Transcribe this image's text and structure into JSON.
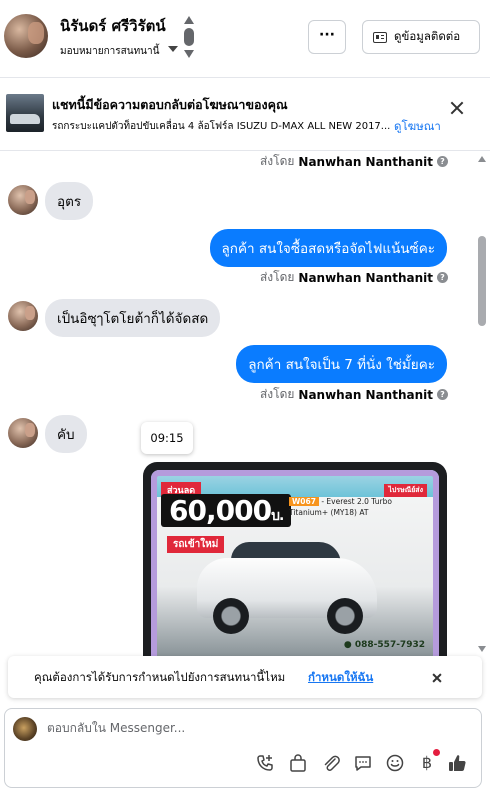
{
  "header": {
    "contact_name": "นิรันดร์ ศรีวิรัตน์",
    "assign_label": "มอบหมายการสนทนานี้",
    "more_label": "···",
    "view_contact_label": "ดูข้อมูลติดต่อ"
  },
  "ad_banner": {
    "title": "แชทนี้มีข้อความตอบกลับต่อโฆษณาของคุณ",
    "description": "รถกระบะแคปตัวท็อปขับเคลื่อน 4 ล้อโฟร์ล ISUZU D-MAX ALL NEW 2017...",
    "link": "ดูโฆษณา"
  },
  "thread": {
    "sent_by_prefix": "ส่งโดย",
    "agent_name": "Nanwhan Nanthanit",
    "info_glyph": "?",
    "messages": [
      {
        "text": "อุตร"
      },
      {
        "text": "ลูกค้า สนใจซื้อสดหรือจัดไฟแน้นซ์คะ"
      },
      {
        "text": "เป็นอิซุๅโตโยต้าก็ได้จัดสด"
      },
      {
        "text": "ลูกค้า สนใจเป็น 7 ที่นั่ง ใช่มั้ยคะ"
      },
      {
        "text": "คับ"
      }
    ],
    "tooltip_time": "09:15",
    "ad_image": {
      "tag": "ส่วนลด",
      "price": "60,000",
      "price_suffix": "บ.",
      "subtitle": "รถเข้าใหม่",
      "model_code": "W067",
      "model_line1": "- Everest 2.0 Turbo",
      "model_line2": "Titanium+ (MY18) AT",
      "corner_tag": "ไปรษณีย์ส่ง",
      "phone": "● 088-557-7932"
    }
  },
  "reminder": {
    "text": "คุณต้องการได้รับการกำหนดไปยังการสนทนานี้ไหม",
    "link": "กำหนดให้ฉัน"
  },
  "composer": {
    "placeholder": "ตอบกลับใน Messenger...",
    "tools": [
      "phone-plus-icon",
      "shopping-bag-icon",
      "paperclip-icon",
      "faq-icon",
      "smile-icon",
      "baht-icon",
      "thumbs-up-icon"
    ],
    "baht_glyph": "฿"
  },
  "colors": {
    "accent": "#0a7cff",
    "link": "#1877f2",
    "incoming_bubble": "#e4e6eb",
    "notification_dot": "#e41e3f"
  }
}
